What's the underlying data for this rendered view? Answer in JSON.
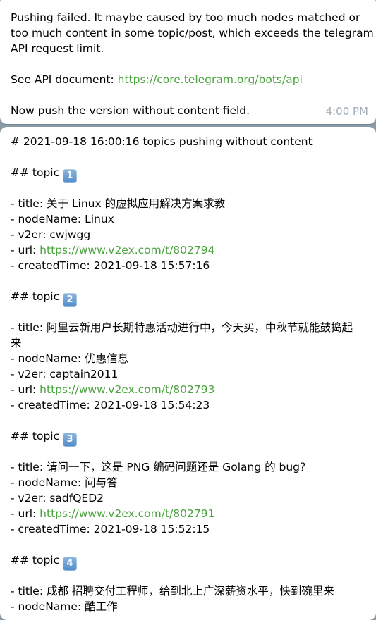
{
  "message_one": {
    "lines": [
      "Pushing failed. It maybe caused by too much nodes matched or",
      "too much content in some topic/post, which exceeds the telegram",
      "API request limit."
    ],
    "api_prefix": "See API document: ",
    "api_link": "https://core.telegram.org/bots/api",
    "final_line": "Now push the version without content field.",
    "time": "4:00 PM"
  },
  "message_two": {
    "header": "# 2021-09-18 16:00:16 topics pushing without content",
    "topics": [
      {
        "heading": "## topic ",
        "number": "1",
        "title": "- title: 关于 Linux 的虚拟应用解决方案求教",
        "title_cont": "",
        "node": "- nodeName: Linux",
        "v2er": "- v2er: cwjwgg",
        "url_prefix": "- url: ",
        "url": "https://www.v2ex.com/t/802794",
        "created": "- createdTime: 2021-09-18 15:57:16"
      },
      {
        "heading": "## topic ",
        "number": "2",
        "title": "- title: 阿里云新用户长期特惠活动进行中，今天买，中秋节就能鼓捣起",
        "title_cont": "来",
        "node": "- nodeName: 优惠信息",
        "v2er": "- v2er: captain2011",
        "url_prefix": "- url: ",
        "url": "https://www.v2ex.com/t/802793",
        "created": "- createdTime: 2021-09-18 15:54:23"
      },
      {
        "heading": "## topic ",
        "number": "3",
        "title": "- title: 请问一下，这是 PNG 编码问题还是 Golang 的 bug？",
        "title_cont": "",
        "node": "- nodeName: 问与答",
        "v2er": "- v2er: sadfQED2",
        "url_prefix": "- url: ",
        "url": "https://www.v2ex.com/t/802791",
        "created": "- createdTime: 2021-09-18 15:52:15"
      },
      {
        "heading": "## topic ",
        "number": "4",
        "title": "- title: 成都 招聘交付工程师，给到北上广深薪资水平，快到碗里来",
        "title_cont": "",
        "node": "- nodeName: 酷工作",
        "v2er": "",
        "url_prefix": "",
        "url": "",
        "created": ""
      }
    ]
  },
  "colors": {
    "background": "#8a9aa6",
    "bubble": "#ffffff",
    "link": "#4aa33e",
    "time": "#a0acb6",
    "keycap": "#4f8cc9"
  }
}
